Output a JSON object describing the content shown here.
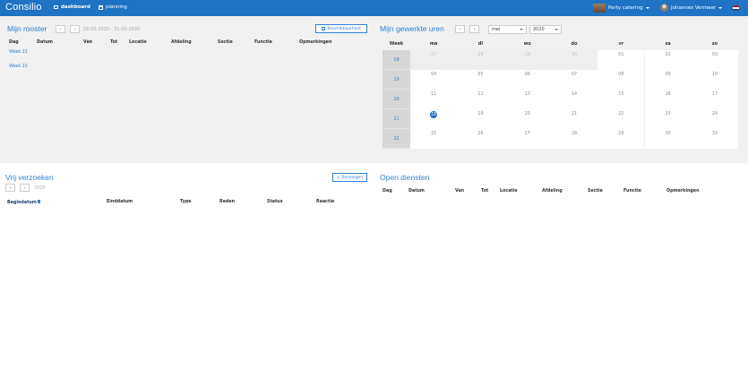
{
  "app": {
    "logo": "Consilio"
  },
  "nav": {
    "dashboard_label": "dashboard",
    "planning_label": "planning"
  },
  "header": {
    "org_label": "Party catering",
    "user_label": "Johannes Vermeer"
  },
  "rooster": {
    "title": "Mijn rooster",
    "prev": "‹",
    "next": "›",
    "range": "18-05-2020 - 31-05-2020",
    "availability_label": "Beschikbaarheid",
    "columns": [
      "Dag",
      "Datum",
      "Van",
      "Tot",
      "Locatie",
      "Afdeling",
      "Sectie",
      "Functie",
      "Opmerkingen"
    ],
    "weeks": [
      "Week 21",
      "Week 22"
    ]
  },
  "uren": {
    "title": "Mijn gewerkte uren",
    "prev": "‹",
    "next": "›",
    "month": "mei",
    "year": "2020",
    "week_header": "Week",
    "days": [
      "ma",
      "di",
      "wo",
      "do",
      "vr",
      "za",
      "zo"
    ],
    "rows": [
      {
        "week": "18",
        "dates": [
          "27",
          "28",
          "29",
          "30",
          "01",
          "02",
          "03"
        ],
        "current": [
          false,
          false,
          false,
          false,
          true,
          true,
          true
        ]
      },
      {
        "week": "19",
        "dates": [
          "04",
          "05",
          "06",
          "07",
          "08",
          "09",
          "10"
        ],
        "current": [
          true,
          true,
          true,
          true,
          true,
          true,
          true
        ]
      },
      {
        "week": "20",
        "dates": [
          "11",
          "12",
          "13",
          "14",
          "15",
          "16",
          "17"
        ],
        "current": [
          true,
          true,
          true,
          true,
          true,
          true,
          true
        ]
      },
      {
        "week": "21",
        "dates": [
          "18",
          "19",
          "20",
          "21",
          "22",
          "23",
          "24"
        ],
        "current": [
          true,
          true,
          true,
          true,
          true,
          true,
          true
        ]
      },
      {
        "week": "22",
        "dates": [
          "25",
          "26",
          "27",
          "28",
          "29",
          "30",
          "31"
        ],
        "current": [
          true,
          true,
          true,
          true,
          true,
          true,
          true
        ]
      }
    ],
    "today": "18"
  },
  "verzoeken": {
    "title": "Vrij verzoeken",
    "prev": "‹",
    "next": "›",
    "year": "2020",
    "add_label": "+ Toevoegen",
    "columns": [
      "Begindatum",
      "Einddatum",
      "Type",
      "Reden",
      "Status",
      "Reactie"
    ]
  },
  "diensten": {
    "title": "Open diensten",
    "columns": [
      "Dag",
      "Datum",
      "Van",
      "Tot",
      "Locatie",
      "Afdeling",
      "Sectie",
      "Functie",
      "Opmerkingen"
    ]
  },
  "colors": {
    "brand": "#1f72c4",
    "accent": "#2f82d1"
  }
}
